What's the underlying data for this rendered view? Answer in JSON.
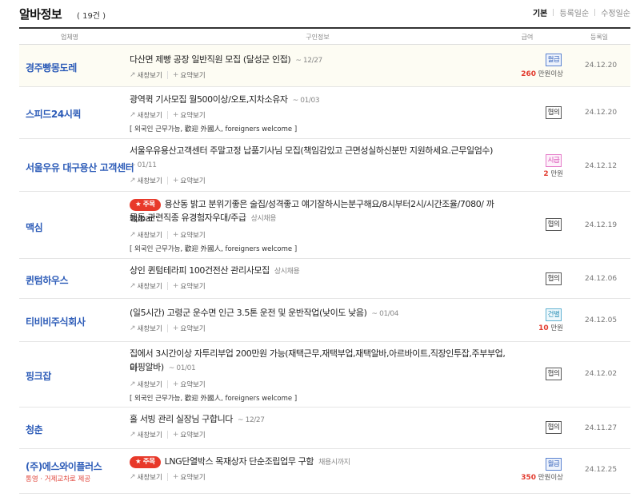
{
  "header": {
    "title": "알바정보",
    "count": "( 19건 )",
    "sort": [
      {
        "label": "기본",
        "active": true
      },
      {
        "label": "등록일순",
        "active": false
      },
      {
        "label": "수정일순",
        "active": false
      }
    ]
  },
  "columns": [
    "업체명",
    "구인정보",
    "급여",
    "등록일"
  ],
  "actions": {
    "map": "새창보기",
    "summary": "요약보기"
  },
  "rows": [
    {
      "company": "경주빵몽도레",
      "title": "다산면 제빵 공장 일반직원 모집 (달성군 인접)",
      "meta": "~ 12/27",
      "pay_type": "월급",
      "pay_value": "260",
      "pay_suffix": " 만원이상",
      "date": "24.12.20"
    },
    {
      "company": "스피드24시퀵",
      "title": "광역퀵 기사모집 월500이상/오토,지차소유자",
      "meta": "~ 01/03",
      "tags": "[ 외국인 근무가능, 歡迎 外國人, foreigners welcome ]",
      "pay_type": "협의",
      "date": "24.12.20"
    },
    {
      "company": "서울우유 대구용산 고객센터",
      "title1": "서울우유용산고객센터 주말고정 납품기사님 모집(책임감있고 근면성실하신분만 지원하세요.근무일엄수)",
      "title2": "~ 01/11",
      "pay_type": "시급",
      "pay_value": "2",
      "pay_suffix": " 만원",
      "date": "24.12.12"
    },
    {
      "company": "맥심",
      "badge": "★ 주목",
      "title1": "용산동 밝고 분위기좋은 술집/성격좋고 얘기잘하시는분구해요/8시부터2시/시간조율/7080/ 까페/bar",
      "title2": "등등 관련직종 유경험자우대/주급",
      "meta": "상시채용",
      "tags": "[ 외국인 근무가능, 歡迎 外國人, foreigners welcome ]",
      "pay_type": "협의",
      "date": "24.12.19"
    },
    {
      "company": "퀸텀하우스",
      "title": "상인 퀸텀테라피 100건전산 관리사모집",
      "meta": "상시채용",
      "pay_type": "협의",
      "date": "24.12.06"
    },
    {
      "company": "티비비주식회사",
      "title": "(일5시간) 고령군 운수면 인근 3.5톤 운전 및 운반작업(낮이도 낮음)",
      "meta": "~ 01/04",
      "pay_type": "건별",
      "pay_value": "10",
      "pay_suffix": " 만원",
      "date": "24.12.05"
    },
    {
      "company": "핑크잡",
      "title1": "집에서 3시간이상 자투리부업 200만원 가능(재택근무,재택부업,재택알바,아르바이트,직장인투잡,주부부업,타",
      "title2": "이핑알바)",
      "meta": "~ 01/01",
      "tags": "[ 외국인 근무가능, 歡迎 外國人, foreigners welcome ]",
      "pay_type": "협의",
      "date": "24.12.02"
    },
    {
      "company": "청춘",
      "title": "홀 서빙 관리 실장님 구합니다",
      "meta": "~ 12/27",
      "pay_type": "협의",
      "date": "24.11.27"
    },
    {
      "company": "(주)에스와이플러스",
      "company_sub": "통영 · 거제교차로 제공",
      "badge": "★ 주목",
      "title": "LNG단열박스 목재상자 단순조립업무 구함",
      "meta": "채용시까지",
      "pay_type": "월급",
      "pay_value": "350",
      "pay_suffix": " 만원이상",
      "date": "24.12.25"
    }
  ],
  "colors": {
    "company": "#2d5cb8",
    "accent": "#e23b2e",
    "highlight_row": "#fdfcf3"
  }
}
